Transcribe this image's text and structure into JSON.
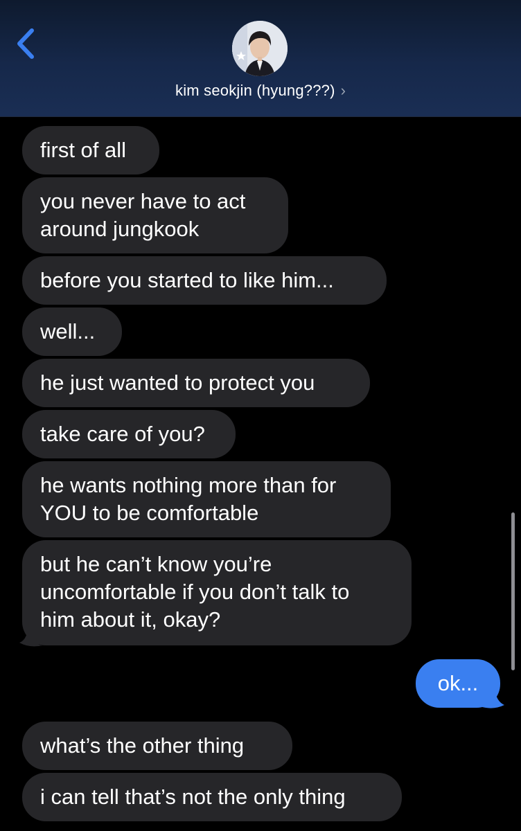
{
  "header": {
    "back_icon": "chevron-left-icon",
    "contact_name": "kim seokjin (hyung???)",
    "chevron": "›",
    "accent_color": "#3a7ff0"
  },
  "messages": [
    {
      "direction": "incoming",
      "text": "first of all"
    },
    {
      "direction": "incoming",
      "text": "you never have to act\naround jungkook"
    },
    {
      "direction": "incoming",
      "text": "before you started to like him..."
    },
    {
      "direction": "incoming",
      "text": "well..."
    },
    {
      "direction": "incoming",
      "text": "he just wanted to protect you"
    },
    {
      "direction": "incoming",
      "text": "take care of you?"
    },
    {
      "direction": "incoming",
      "text": "he wants nothing more than for\nYOU to be comfortable"
    },
    {
      "direction": "incoming",
      "text": "but he can’t know you’re\nuncomfortable if you don’t talk to\nhim about it, okay?"
    },
    {
      "direction": "outgoing",
      "text": "ok..."
    },
    {
      "direction": "incoming",
      "text": "what’s the other thing"
    },
    {
      "direction": "incoming",
      "text": "i can tell that’s not the only thing"
    }
  ],
  "colors": {
    "incoming_bubble": "#262629",
    "outgoing_bubble": "#3a7ff0",
    "background": "#000000"
  }
}
